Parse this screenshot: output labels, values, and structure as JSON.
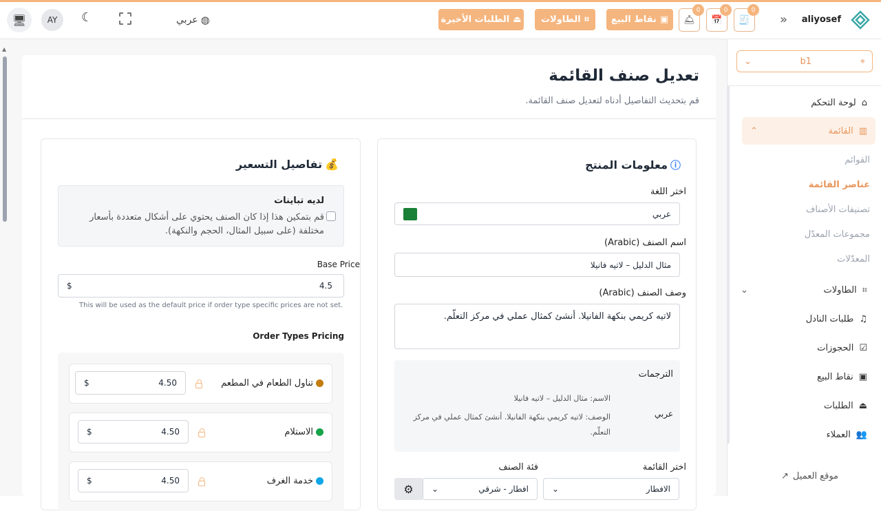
{
  "colors": {
    "accent": "#f5b57e",
    "active_text": "#e8955b",
    "active_bg": "#fdf1e7"
  },
  "topbar": {
    "brand": "aliyosef",
    "recent_orders": "الطلبات الأخيرة",
    "tables": "الطاولات",
    "pos": "نقاط البيع",
    "badge_1": "0",
    "badge_2": "0",
    "badge_3": "0",
    "language": "عربي",
    "avatar": "AY"
  },
  "sidebar": {
    "branch": "b1",
    "items": [
      {
        "label": "لوحة التحكم",
        "icon": "home-icon"
      },
      {
        "label": "القائمة",
        "icon": "menu-icon"
      },
      {
        "label": "الطاولات",
        "icon": "tables-icon"
      },
      {
        "label": "طلبات النادل",
        "icon": "bell-icon"
      },
      {
        "label": "الحجوزات",
        "icon": "calendar-icon"
      },
      {
        "label": "نقاط البيع",
        "icon": "pos-icon"
      },
      {
        "label": "الطلبات",
        "icon": "orders-icon"
      },
      {
        "label": "العملاء",
        "icon": "users-icon"
      }
    ],
    "sub": [
      "القوائم",
      "عناصر القائمة",
      "تصنيفات الأصناف",
      "مجموعات المعدّل",
      "المعدّلات"
    ],
    "customer_site": "موقع العميل"
  },
  "page": {
    "title": "تعديل صنف القائمة",
    "subtitle": "قم بتحديث التفاصيل أدناه لتعديل صنف القائمة."
  },
  "product": {
    "heading": "معلومات المنتج",
    "lang_label": "اختر اللغة",
    "lang_value": "عربي",
    "name_label": "اسم الصنف (Arabic)",
    "name_value": "مثال الدليل – لاتيه فانيلا",
    "desc_label": "وصف الصنف (Arabic)",
    "desc_value": "لاتيه كريمي بنكهة الفانيلا. أنشئ كمثال عملي في مركز التعلّم.",
    "translations_label": "الترجمات",
    "trans_lang": "عربي",
    "trans_name": "الاسم: مثال الدليل – لاتيه فانيلا",
    "trans_desc": "الوصف: لاتيه كريمي بنكهة الفانيلا. أنشئ كمثال عملي في مركز التعلّم.",
    "menu_label": "اختر القائمة",
    "menu_value": "الافطار",
    "category_label": "فئة الصنف",
    "category_value": "افطار - شرقي"
  },
  "pricing": {
    "heading": "تفاصيل التسعير",
    "variants_title": "لديه تباينات",
    "variants_desc": "قم بتمكين هذا إذا كان الصنف يحتوي على أشكال متعددة بأسعار مختلفة (على سبيل المثال، الحجم والنكهة).",
    "base_label": "Base Price",
    "base_value": "4.5",
    "currency": "$",
    "base_hint": "This will be used as the default price if order type specific prices are not set.",
    "order_types_label": "Order Types Pricing",
    "types": [
      {
        "label": "تناول الطعام في المطعم",
        "value": "4.50",
        "color": "#c27c0e"
      },
      {
        "label": "الاستلام",
        "value": "4.50",
        "color": "#16a34a"
      },
      {
        "label": "خدمة الغرف",
        "value": "4.50",
        "color": "#0ea5e9"
      }
    ]
  }
}
